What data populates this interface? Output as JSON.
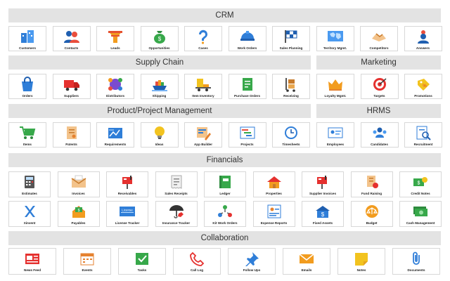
{
  "sections": {
    "crm": "CRM",
    "supply_chain": "Supply Chain",
    "marketing": "Marketing",
    "product_project": "Product/Project Management",
    "hrms": "HRMS",
    "financials": "Financials",
    "collaboration": "Collaboration"
  },
  "crm": [
    "Customers",
    "Contacts",
    "Leads",
    "Opportunities",
    "Cases",
    "Work Orders",
    "Sales Planning",
    "Territory Mgmt.",
    "Competitors",
    "Answers"
  ],
  "supply_chain": [
    "Orders",
    "Suppliers",
    "Distributors",
    "Shipping",
    "Item Inventory",
    "Purchase Orders",
    "Receiving"
  ],
  "marketing": [
    "Loyalty Mgmt.",
    "Targets",
    "Promotions"
  ],
  "product_project": [
    "Items",
    "Patents",
    "Requirements",
    "Ideas",
    "App Builder",
    "Projects",
    "Timesheets"
  ],
  "hrms": [
    "Employees",
    "Candidates",
    "Recruitment"
  ],
  "financials_row1": [
    "Estimates",
    "Invoices",
    "Receivables",
    "Sales Receipts",
    "Ledger",
    "Properties",
    "Supplier Invoices",
    "Fund Raising",
    "Credit Notes"
  ],
  "financials_row2": [
    "Xinvent",
    "Payables",
    "License Tracker",
    "Insurance Tracker",
    "Kit Work Orders",
    "Expense Reports",
    "Fixed Assets",
    "Budget",
    "Cash Management"
  ],
  "collaboration": [
    "News Feed",
    "Events",
    "Tasks",
    "Call Log",
    "Follow Ups",
    "Emails",
    "Notes",
    "Documents"
  ],
  "license_badge": "License"
}
